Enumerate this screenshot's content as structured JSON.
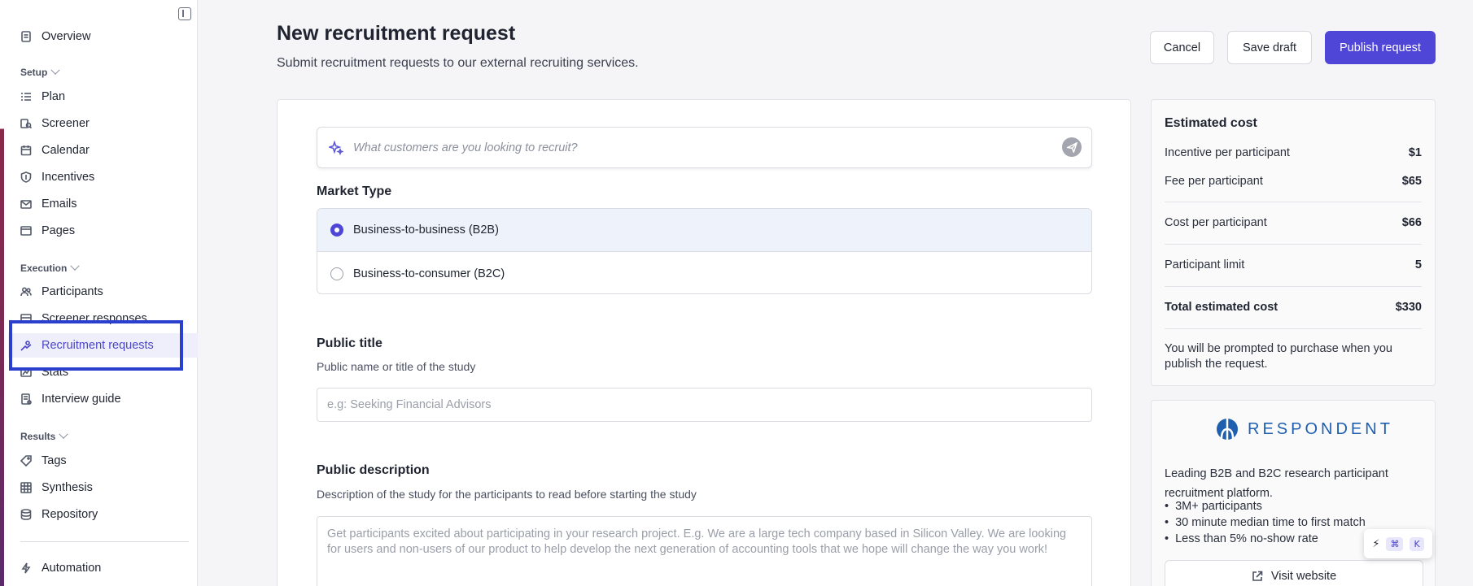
{
  "sidebar": {
    "overview": "Overview",
    "sections": {
      "setup": "Setup",
      "execution": "Execution",
      "results": "Results"
    },
    "setup_items": [
      "Plan",
      "Screener",
      "Calendar",
      "Incentives",
      "Emails",
      "Pages"
    ],
    "execution_items": [
      "Participants",
      "Screener responses",
      "Recruitment requests",
      "Stats",
      "Interview guide"
    ],
    "results_items": [
      "Tags",
      "Synthesis",
      "Repository"
    ],
    "automation": "Automation",
    "active_item": "Recruitment requests"
  },
  "header": {
    "title": "New recruitment request",
    "subtitle": "Submit recruitment requests to our external recruiting services.",
    "cancel_label": "Cancel",
    "save_draft_label": "Save draft",
    "publish_label": "Publish request"
  },
  "form": {
    "ai_placeholder": "What customers are you looking to recruit?",
    "market_type_label": "Market Type",
    "market_options": [
      "Business-to-business (B2B)",
      "Business-to-consumer (B2C)"
    ],
    "selected_market": "Business-to-business (B2B)",
    "public_title_label": "Public title",
    "public_title_help": "Public name or title of the study",
    "public_title_placeholder": "e.g: Seeking Financial Advisors",
    "public_description_label": "Public description",
    "public_description_help": "Description of the study for the participants to read before starting the study",
    "public_description_placeholder": "Get participants excited about participating in your research project. E.g. We are a large tech company based in Silicon Valley. We are looking for users and non-users of our product to help develop the next generation of accounting tools that we hope will change the way you work!"
  },
  "cost": {
    "title": "Estimated cost",
    "rows": [
      {
        "label": "Incentive per participant",
        "value": "$1"
      },
      {
        "label": "Fee per participant",
        "value": "$65"
      },
      {
        "label": "Cost per participant",
        "value": "$66"
      },
      {
        "label": "Participant limit",
        "value": "5"
      },
      {
        "label": "Total estimated cost",
        "value": "$330"
      }
    ],
    "note": "You will be prompted to purchase when you publish the request."
  },
  "vendor": {
    "name": "RESPONDENT",
    "description": "Leading B2B and B2C research participant recruitment platform.",
    "bullets": [
      "3M+ participants",
      "30 minute median time to first match",
      "Less than 5% no-show rate"
    ],
    "visit_label": "Visit website",
    "brand_color": "#1e5fb0"
  },
  "shortcut": {
    "key1": "⌘",
    "key2": "K"
  },
  "colors": {
    "accent": "#4f46d8",
    "highlight_box": "#2b3fcf"
  }
}
